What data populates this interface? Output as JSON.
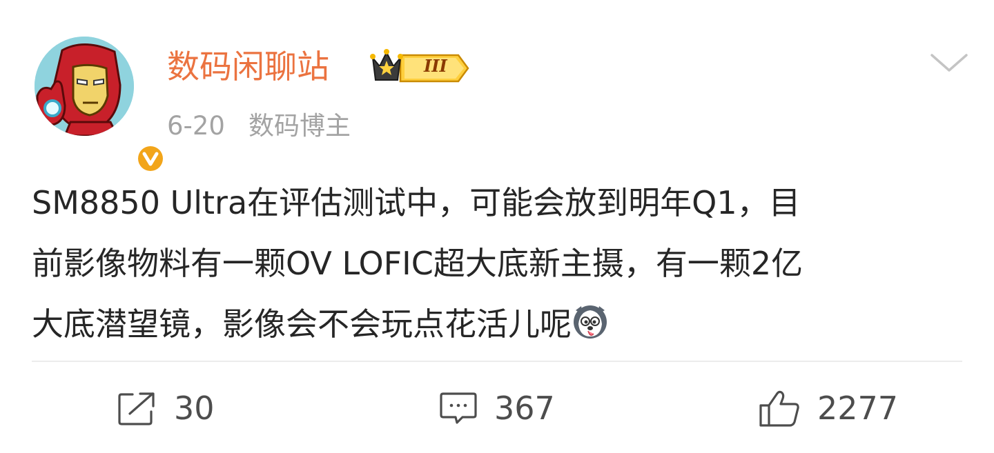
{
  "author": {
    "name": "数码闲聊站",
    "level_badge": "III",
    "verified_icon": "verified-v-icon",
    "avatar_icon": "ironman-avatar"
  },
  "meta": {
    "date": "6-20",
    "role": "数码博主"
  },
  "post": {
    "lines": [
      "SM8850 Ultra在评估测试中，可能会放到明年Q1，目",
      "前影像物料有一颗OV LOFIC超大底新主摄，有一颗2亿",
      "大底潜望镜，影像会不会玩点花活儿呢"
    ],
    "emoji": "husky-emoji"
  },
  "actions": {
    "repost": {
      "icon": "repost-icon",
      "count": "30"
    },
    "comment": {
      "icon": "comment-icon",
      "count": "367"
    },
    "like": {
      "icon": "thumbs-up-icon",
      "count": "2277"
    }
  },
  "colors": {
    "username": "#eb7340",
    "meta": "#a3a3a3",
    "text": "#262626",
    "badge_gold": "#f5b800"
  }
}
